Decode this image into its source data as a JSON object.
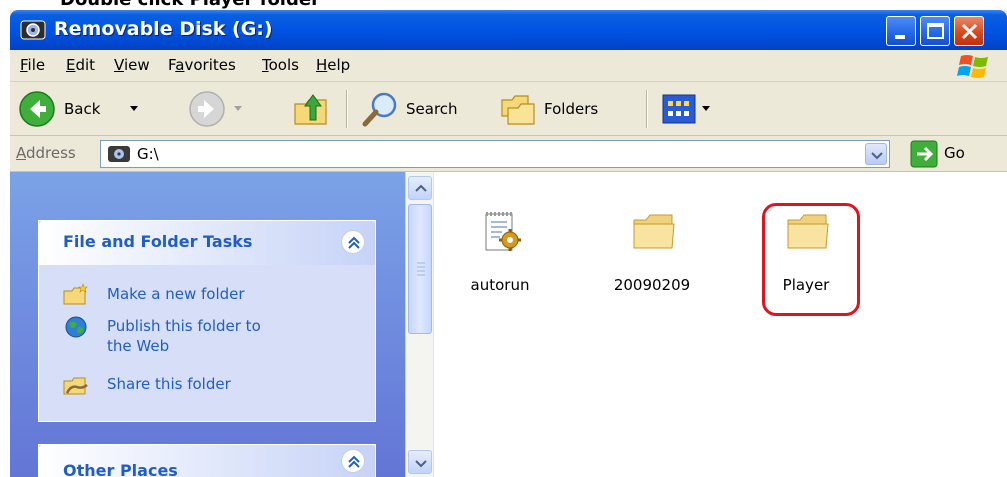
{
  "caption": "Double click Player folder",
  "window": {
    "title": "Removable Disk (G:)",
    "controls": [
      "minimize",
      "maximize",
      "close"
    ]
  },
  "menu": {
    "items": [
      {
        "first": "F",
        "rest": "ile"
      },
      {
        "first": "E",
        "rest": "dit"
      },
      {
        "first": "V",
        "rest": "iew"
      },
      {
        "pre": "F",
        "first": "a",
        "rest": "vorites"
      },
      {
        "first": "T",
        "rest": "ools"
      },
      {
        "first": "H",
        "rest": "elp"
      }
    ]
  },
  "toolbar": {
    "back_label": "Back",
    "search_label": "Search",
    "folders_label": "Folders"
  },
  "address": {
    "label_first": "A",
    "label_middle": "d",
    "label_rest": "dress",
    "value": "G:\\",
    "go_label": "Go"
  },
  "tasks": {
    "file_folder": {
      "title": "File and Folder Tasks",
      "items": [
        {
          "label": "Make a new folder",
          "icon": "new-folder-icon"
        },
        {
          "label_line1": "Publish this folder to",
          "label_line2": "the Web",
          "icon": "publish-globe-icon"
        },
        {
          "label": "Share this folder",
          "icon": "share-folder-icon"
        }
      ]
    },
    "other_places": {
      "title": "Other Places"
    }
  },
  "files": [
    {
      "name": "autorun",
      "icon": "settings-file-icon"
    },
    {
      "name": "20090209",
      "icon": "folder-icon"
    },
    {
      "name": "Player",
      "icon": "folder-icon",
      "highlighted": true
    }
  ],
  "colors": {
    "titlebar": "#0054e3",
    "task_link": "#215dc6",
    "task_pane": "#7ba2e7",
    "highlight": "#e0141e"
  }
}
